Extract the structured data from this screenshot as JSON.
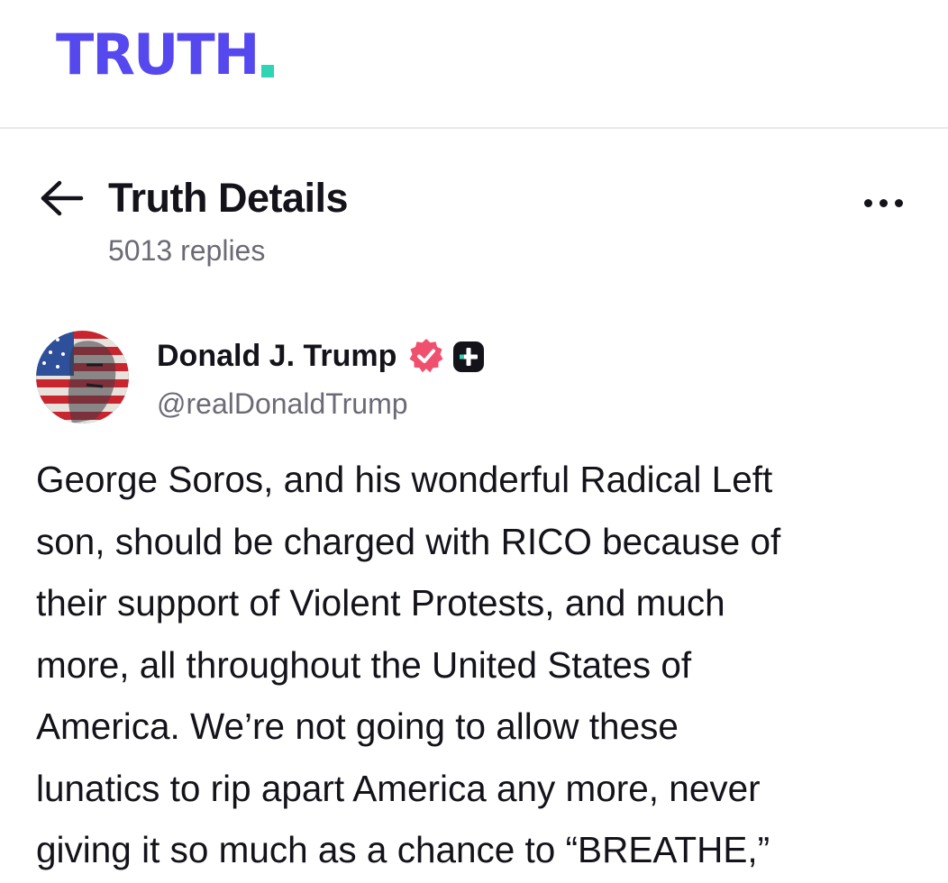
{
  "brand": {
    "logo_text": "TRUTH",
    "logo_color": "#5448ee",
    "logo_dot_color": "#2fd4b4"
  },
  "header": {
    "back_icon": "arrow-left-icon",
    "title": "Truth Details",
    "replies": "5013 replies",
    "more_icon": "ellipsis-icon"
  },
  "author": {
    "name": "Donald J. Trump",
    "handle": "@realDonaldTrump",
    "verified_icon": "verified-badge-icon",
    "verified_color": "#f0506e",
    "plus_icon": "plus-badge-icon"
  },
  "post": {
    "lines": [
      "George Soros, and his wonderful Radical Left",
      "son, should be charged with RICO because of",
      "their support of Violent Protests, and much",
      "more, all throughout the United States of",
      "America. We’re not going to allow these",
      "lunatics to rip apart America any more, never",
      "giving it so much as a chance to “BREATHE,”"
    ]
  }
}
